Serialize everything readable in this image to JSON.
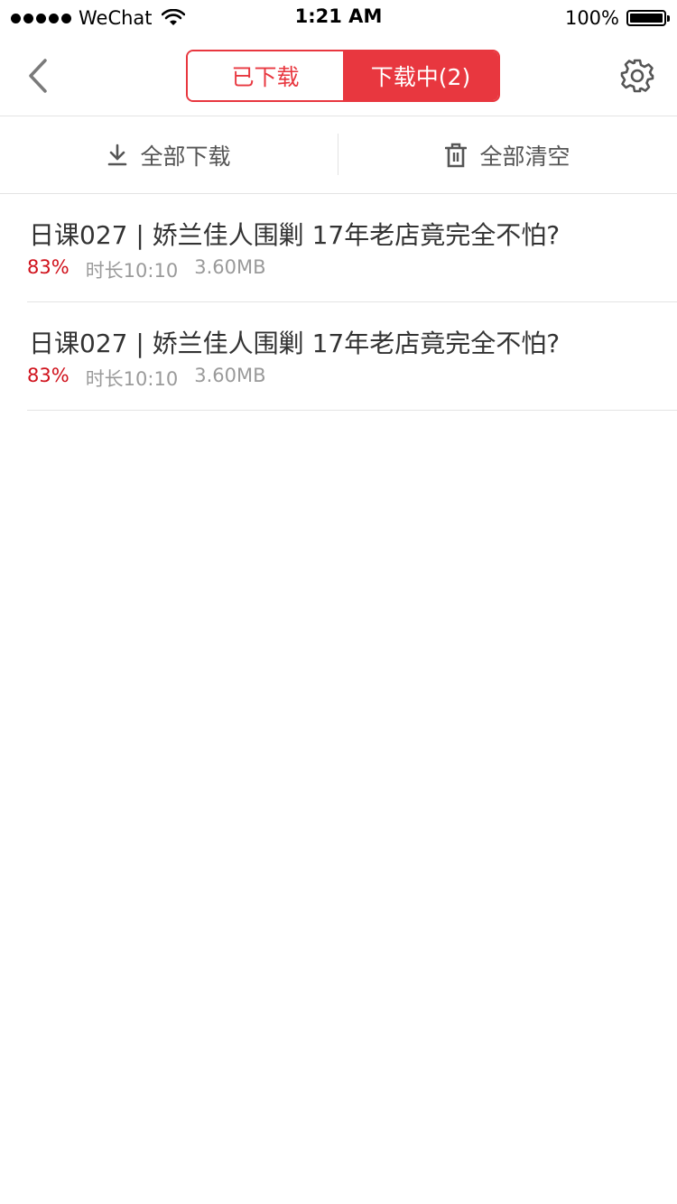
{
  "statusbar": {
    "carrier": "WeChat",
    "time": "1:21 AM",
    "battery": "100%"
  },
  "nav": {
    "tabs": [
      {
        "label": "已下载",
        "active": false
      },
      {
        "label": "下载中(2)",
        "active": true
      }
    ]
  },
  "actions": {
    "download_all": "全部下载",
    "clear_all": "全部清空"
  },
  "colors": {
    "accent": "#e8373f",
    "progress": "#d0111b"
  },
  "items": [
    {
      "title": "日课027 | 娇兰佳人围剿 17年老店竟完全不怕?",
      "progress": "83%",
      "duration": "时长10:10",
      "size": "3.60MB"
    },
    {
      "title": "日课027 | 娇兰佳人围剿 17年老店竟完全不怕?",
      "progress": "83%",
      "duration": "时长10:10",
      "size": "3.60MB"
    }
  ]
}
